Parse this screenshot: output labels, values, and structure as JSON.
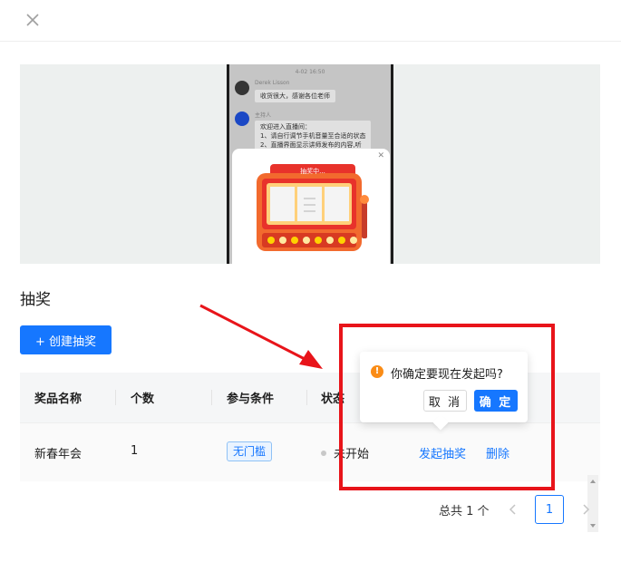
{
  "page": {
    "section_title": "抽奖",
    "create_button_label": "+ 创建抽奖"
  },
  "preview": {
    "chat_time": "4-02 16:50",
    "messages": [
      {
        "name": "Derek Lisson",
        "text": "收货很大，感谢各位老师"
      },
      {
        "name": "主持人",
        "lines": [
          "欢迎进入直播间：",
          "1、请自行调节手机音量至合适的状态",
          "2、直播界面显示讲师发布的内容,听"
        ]
      }
    ],
    "machine_banner": "抽奖中..."
  },
  "table": {
    "columns": [
      "奖品名称",
      "个数",
      "参与条件",
      "状态"
    ],
    "rows": [
      {
        "prize_name": "新春年会",
        "count": "1",
        "condition": "无门槛",
        "status": "未开始",
        "actions": [
          "发起抽奖",
          "删除"
        ]
      }
    ]
  },
  "popconfirm": {
    "title": "你确定要现在发起吗?",
    "cancel_label": "取 消",
    "ok_label": "确 定"
  },
  "pagination": {
    "total_text": "总共 1 个",
    "current_page": "1"
  },
  "colors": {
    "primary": "#1677ff",
    "annotation_red": "#e8141a",
    "warning": "#fa8c16"
  },
  "icons": [
    "close-icon",
    "warning-icon",
    "chevron-left-icon",
    "chevron-right-icon",
    "scroll-up-icon",
    "scroll-down-icon"
  ]
}
